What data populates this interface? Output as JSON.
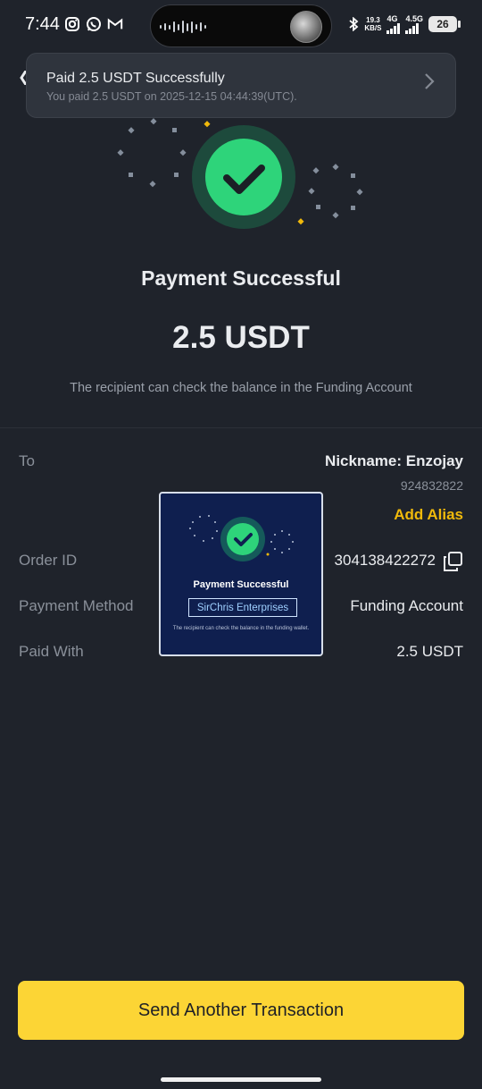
{
  "status_bar": {
    "time": "7:44",
    "net_speed_value": "19.3",
    "net_speed_unit": "KB/S",
    "network_1": "4G",
    "network_2": "4.5G",
    "battery": "26",
    "icons": [
      "instagram-icon",
      "whatsapp-icon",
      "gmail-icon",
      "bluetooth-icon"
    ]
  },
  "toast": {
    "title": "Paid 2.5 USDT Successfully",
    "subtitle": "You paid 2.5 USDT on 2025-12-15 04:44:39(UTC)."
  },
  "hero": {
    "title": "Payment Successful",
    "amount": "2.5 USDT",
    "note": "The recipient can check the balance in the Funding Account"
  },
  "details": {
    "to_label": "To",
    "nickname": "Nickname: Enzojay",
    "uid": "924832822",
    "add_alias": "Add Alias",
    "order_label": "Order ID",
    "order_value": "304138422272",
    "method_label": "Payment Method",
    "method_value": "Funding Account",
    "paid_with_label": "Paid With",
    "paid_with_value": "2.5 USDT"
  },
  "overlay": {
    "title": "Payment Successful",
    "name": "SirChris Enterprises",
    "note": "The recipient can check the balance in the funding wallet."
  },
  "actions": {
    "send_another": "Send Another Transaction"
  },
  "colors": {
    "background": "#1f232b",
    "accent_yellow": "#fcd535",
    "alias_yellow": "#f0b90b",
    "success_green": "#2ed47a"
  }
}
